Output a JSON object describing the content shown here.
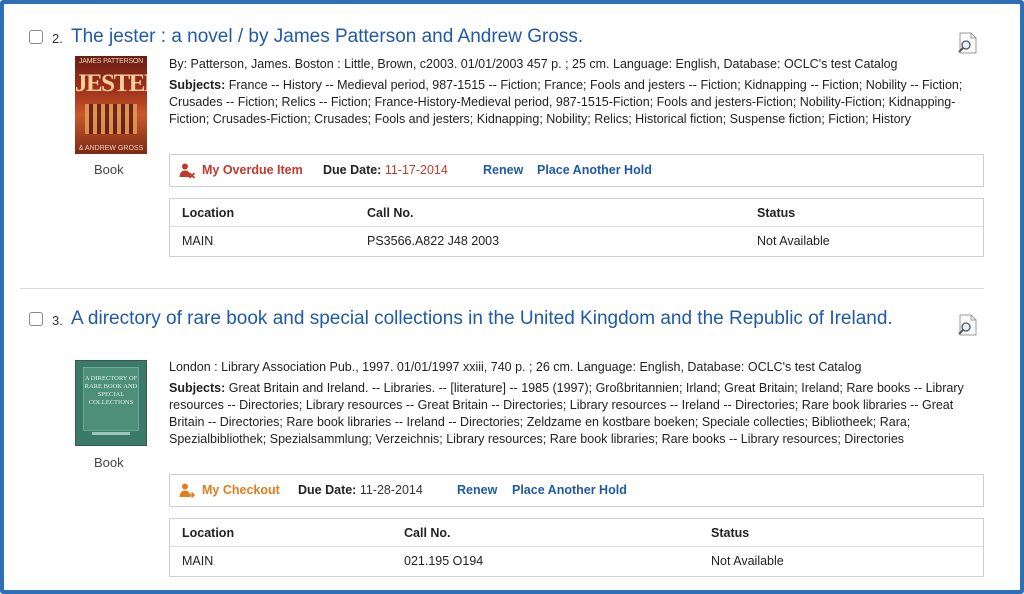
{
  "results": [
    {
      "number": "2.",
      "title": "The jester : a novel / by James Patterson and Andrew Gross.",
      "cover": {
        "author": "JAMES PATTERSON",
        "title": "JESTER",
        "coauthor": "& ANDREW GROSS"
      },
      "format": "Book",
      "description": "By: Patterson, James. Boston : Little, Brown, c2003. 01/01/2003 457 p. ; 25 cm. Language: English, Database: OCLC's test Catalog",
      "subjects_label": "Subjects:",
      "subjects": "France -- History -- Medieval period, 987-1515 -- Fiction; France; Fools and jesters -- Fiction; Kidnapping -- Fiction; Nobility -- Fiction; Crusades -- Fiction; Relics -- Fiction; France-History-Medieval period, 987-1515-Fiction; Fools and jesters-Fiction; Nobility-Fiction; Kidnapping-Fiction; Crusades-Fiction; Crusades; Fools and jesters; Kidnapping; Nobility; Relics; Historical fiction; Suspense fiction; Fiction; History",
      "status": {
        "label": "My Overdue Item",
        "due_label": "Due Date:",
        "due_value": "11-17-2014",
        "renew": "Renew",
        "hold": "Place Another Hold",
        "color": "#c0392b"
      },
      "holdings": {
        "headers": [
          "Location",
          "Call No.",
          "Status"
        ],
        "row": [
          "MAIN",
          "PS3566.A822 J48 2003",
          "Not Available"
        ]
      }
    },
    {
      "number": "3.",
      "title": "A directory of rare book and special collections in the United Kingdom and the Republic of Ireland.",
      "cover": {
        "text": "A DIRECTORY OF RARE BOOK AND SPECIAL COLLECTIONS"
      },
      "format": "Book",
      "description": "London : Library Association Pub., 1997. 01/01/1997 xxiii, 740 p. ; 26 cm. Language: English, Database: OCLC's test Catalog",
      "subjects_label": "Subjects:",
      "subjects": "Great Britain and Ireland. -- Libraries. -- [literature] -- 1985 (1997); Großbritannien; Irland; Great Britain; Ireland; Rare books -- Library resources -- Directories; Library resources -- Great Britain -- Directories; Library resources -- Ireland -- Directories; Rare book libraries -- Great Britain -- Directories; Rare book libraries -- Ireland -- Directories; Zeldzame en kostbare boeken; Speciale collecties; Bibliotheek; Rara; Spezialbibliothek; Spezialsammlung; Verzeichnis; Library resources; Rare book libraries; Rare books -- Library resources; Directories",
      "status": {
        "label": "My Checkout",
        "due_label": "Due Date:",
        "due_value": "11-28-2014",
        "renew": "Renew",
        "hold": "Place Another Hold",
        "color": "#e27d1c"
      },
      "holdings": {
        "headers": [
          "Location",
          "Call No.",
          "Status"
        ],
        "row": [
          "MAIN",
          "021.195 O194",
          "Not Available"
        ]
      }
    }
  ]
}
